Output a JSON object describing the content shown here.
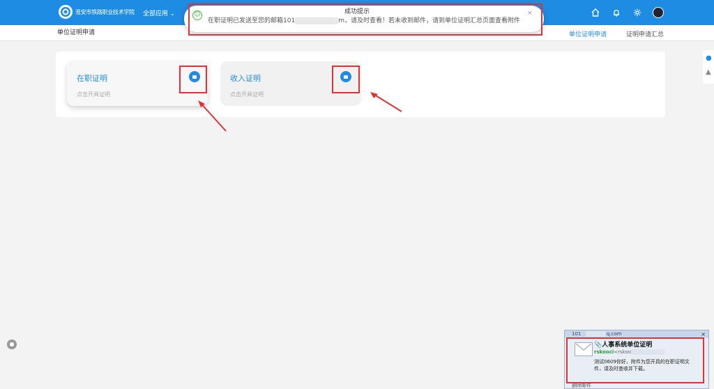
{
  "header": {
    "org_name": "淮安市铁路职业技术学院",
    "all_apps": "全部应用"
  },
  "subbar": {
    "breadcrumb": "单位证明申请",
    "tabs": [
      {
        "label": "单位证明申请",
        "active": true
      },
      {
        "label": "证明申请汇总",
        "active": false
      }
    ]
  },
  "toast": {
    "title": "成功提示",
    "message_start": "在职证明已发送至您的邮箱101",
    "message_end": "m，请及时查看！若未收到邮件，请到单位证明汇总页面查看附件",
    "close": "×"
  },
  "cards": [
    {
      "title": "在职证明",
      "subtitle": "点击开具证明"
    },
    {
      "title": "收入证明",
      "subtitle": "点击开具证明"
    }
  ],
  "mail_popup": {
    "header_from": "101",
    "header_domain": "q.com",
    "subject": "人事系统单位证明",
    "sender_name": "rskooci",
    "sender_rest": "<rskoo",
    "body": "测试0609你好，附件为您开具的在职证明文件，请及时查收并下载。",
    "footer": "删除邮件",
    "close": "×"
  },
  "colors": {
    "primary": "#1e8ce3",
    "highlight": "#dd3333",
    "success": "#46b549"
  }
}
